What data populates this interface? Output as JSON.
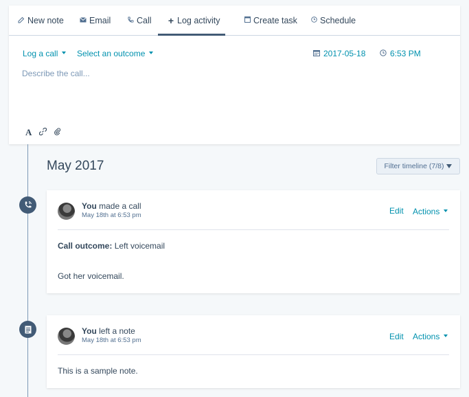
{
  "composer": {
    "tabs": [
      {
        "label": "New note",
        "icon": "edit-icon"
      },
      {
        "label": "Email",
        "icon": "email-icon"
      },
      {
        "label": "Call",
        "icon": "phone-icon"
      },
      {
        "label": "Log activity",
        "icon": "plus-icon"
      },
      {
        "label": "Create task",
        "icon": "task-icon"
      },
      {
        "label": "Schedule",
        "icon": "clock-icon"
      }
    ],
    "active_tab": "Log activity",
    "activity_type": "Log a call",
    "outcome": "Select an outcome",
    "date": "2017-05-18",
    "time": "6:53 PM",
    "description_placeholder": "Describe the call..."
  },
  "timeline": {
    "month": "May 2017",
    "filter_label": "Filter timeline (7/8)",
    "entries": [
      {
        "type": "call",
        "icon": "phone-icon",
        "actor": "You",
        "action": "made a call",
        "timestamp": "May 18th at 6:53 pm",
        "edit_label": "Edit",
        "actions_label": "Actions",
        "outcome_label": "Call outcome:",
        "outcome_value": "Left voicemail",
        "body": "Got her voicemail."
      },
      {
        "type": "note",
        "icon": "note-icon",
        "actor": "You",
        "action": "left a note",
        "timestamp": "May 18th at 6:53 pm",
        "edit_label": "Edit",
        "actions_label": "Actions",
        "body": "This is a sample note."
      }
    ]
  },
  "colors": {
    "link": "#0091ae",
    "text": "#33475b",
    "timeline_node": "#425b76",
    "background": "#f5f8fa"
  }
}
